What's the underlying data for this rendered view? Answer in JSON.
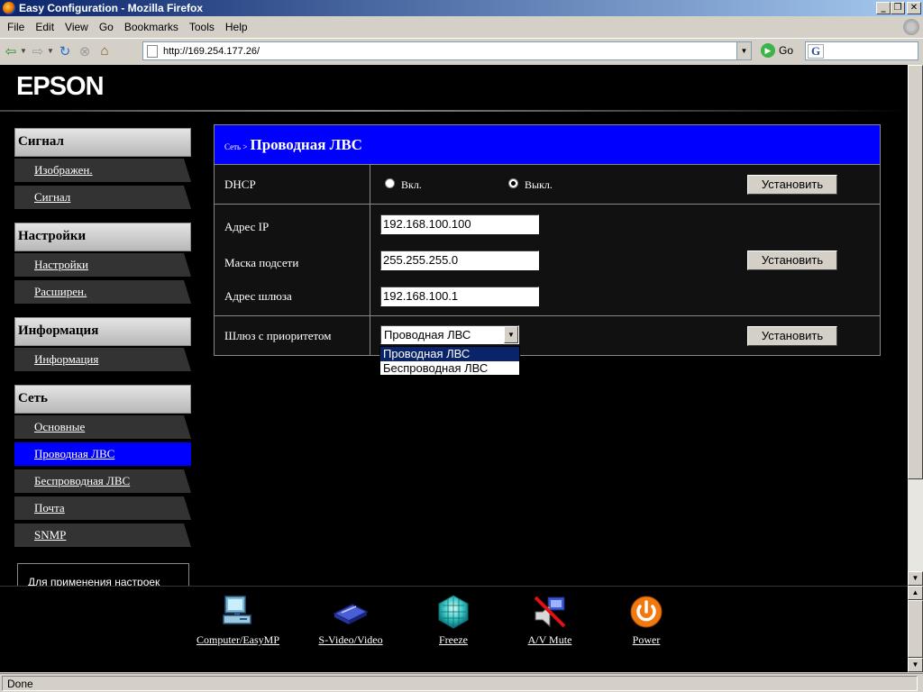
{
  "window": {
    "title": "Easy Configuration - Mozilla Firefox",
    "buttons": [
      "_",
      "❐",
      "✕"
    ]
  },
  "menu": {
    "items": [
      "File",
      "Edit",
      "View",
      "Go",
      "Bookmarks",
      "Tools",
      "Help"
    ]
  },
  "nav": {
    "url": "http://169.254.177.26/",
    "go_label": "Go",
    "search_engine_glyph": "G"
  },
  "brand": {
    "logo": "EPSON"
  },
  "sidebar": {
    "sections": [
      {
        "title": "Сигнал",
        "items": [
          "Изображен.",
          "Сигнал"
        ]
      },
      {
        "title": "Настройки",
        "items": [
          "Настройки",
          "Расширен."
        ]
      },
      {
        "title": "Информация",
        "items": [
          "Информация"
        ]
      },
      {
        "title": "Сеть",
        "items": [
          "Основные",
          "Проводная ЛВС",
          "Беспроводная ЛВС",
          "Почта",
          "SNMP"
        ]
      }
    ],
    "active_item": "Проводная ЛВС",
    "apply_note": "Для применения настроек"
  },
  "panel": {
    "breadcrumb": "Сеть >",
    "title": "Проводная ЛВС",
    "dhcp": {
      "label": "DHCP",
      "options": [
        "Вкл.",
        "Выкл."
      ],
      "selected": "Выкл.",
      "button": "Установить"
    },
    "ip": {
      "ip_label": "Адрес IP",
      "ip_value": "192.168.100.100",
      "mask_label": "Маска подсети",
      "mask_value": "255.255.255.0",
      "gw_label": "Адрес шлюза",
      "gw_value": "192.168.100.1",
      "button": "Установить"
    },
    "priority": {
      "label": "Шлюз с приоритетом",
      "selected": "Проводная ЛВС",
      "options": [
        "Проводная ЛВС",
        "Беспроводная ЛВС"
      ],
      "button": "Установить"
    }
  },
  "bottom": {
    "items": [
      "Computer/EasyMP",
      "S-Video/Video",
      "Freeze",
      "A/V Mute",
      "Power"
    ]
  },
  "status": {
    "text": "Done"
  }
}
